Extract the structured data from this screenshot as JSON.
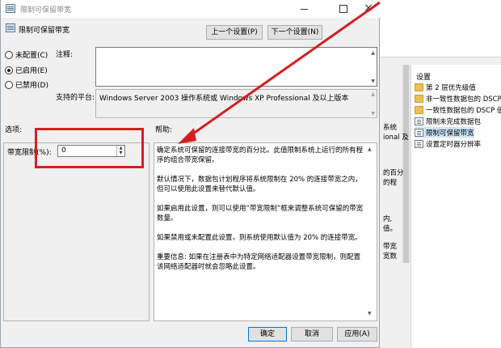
{
  "dialog": {
    "title": "限制可保留带宽",
    "policy_name": "限制可保留带宽",
    "close_glyph": "×",
    "prev_button": "上一个设置(P)",
    "next_button": "下一个设置(N)",
    "radio_not_configured": "未配置(C)",
    "radio_enabled": "已启用(E)",
    "radio_disabled": "已禁用(D)",
    "selected_radio": "enabled",
    "comment_label": "注释:",
    "comment_value": "",
    "platform_label": "支持的平台:",
    "platform_value": "Windows Server 2003 操作系统或 Windows XP Professional 及以上版本",
    "options_label": "选项:",
    "help_label": "帮助:",
    "bandwidth_label": "带宽限制(%):",
    "bandwidth_value": "0",
    "help_paragraphs": [
      "确定系统可保留的连接带宽的百分比。此值限制系统上运行的所有程序的组合带宽保留。",
      "默认情况下，数据包计划程序将系统限制在 20% 的连接带宽之内，但可以使用此设置来替代默认值。",
      "如果启用此设置，则可以使用“带宽限制”框来调整系统可保留的带宽数量。",
      "如果禁用或未配置此设置，则系统使用默认值为 20% 的连接带宽。",
      "重要信息: 如果在注册表中为特定网络适配器设置带宽限制，则配置该网络适配器时就会忽略此设置。"
    ],
    "ok_button": "确定",
    "cancel_button": "取消",
    "apply_button": "应用(A)"
  },
  "background_window": {
    "heading": "设置",
    "items": [
      {
        "label": "第 2 层优先级值",
        "icon": "folder-icon"
      },
      {
        "label": "非一致性数据包的 DSCP 值",
        "icon": "folder-icon"
      },
      {
        "label": "一致性数据包的 DSCP 值",
        "icon": "folder-icon"
      },
      {
        "label": "限制未完成数据包",
        "icon": "policy-page-icon"
      },
      {
        "label": "限制可保留带宽",
        "icon": "policy-page-icon"
      },
      {
        "label": "设置定时器分辨率",
        "icon": "policy-page-icon"
      }
    ],
    "selected_item": 4,
    "fragments": [
      "系统",
      "ional 及",
      "的百分",
      "的程",
      "内,",
      "值。",
      "带宽",
      "宽数"
    ]
  },
  "annotation": {
    "color": "#d51f1f"
  }
}
